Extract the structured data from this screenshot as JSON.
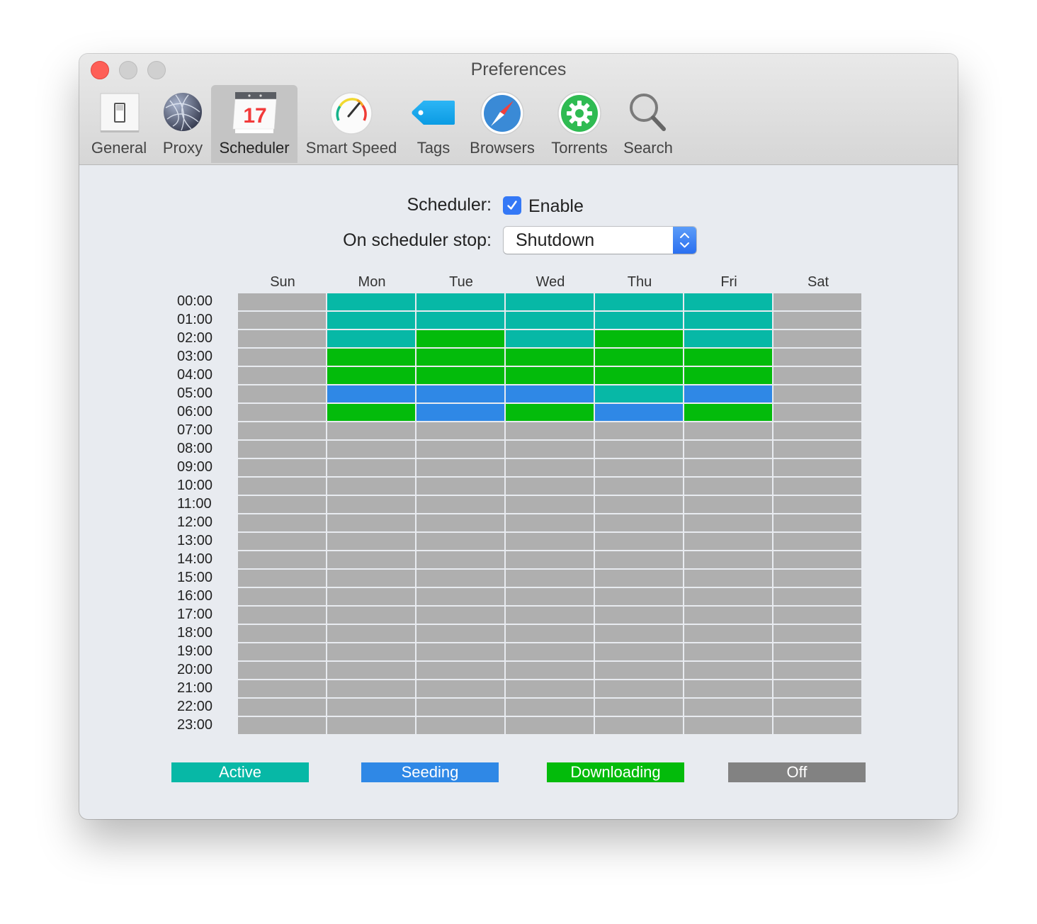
{
  "window": {
    "title": "Preferences"
  },
  "toolbar": {
    "items": [
      {
        "label": "General",
        "icon": "switch-icon"
      },
      {
        "label": "Proxy",
        "icon": "globe-network-icon"
      },
      {
        "label": "Scheduler",
        "icon": "calendar-icon",
        "calendar_day": "17",
        "selected": true
      },
      {
        "label": "Smart Speed",
        "icon": "speedometer-icon"
      },
      {
        "label": "Tags",
        "icon": "tag-icon"
      },
      {
        "label": "Browsers",
        "icon": "compass-icon"
      },
      {
        "label": "Torrents",
        "icon": "gear-icon"
      },
      {
        "label": "Search",
        "icon": "magnifier-icon"
      }
    ]
  },
  "scheduler": {
    "enable_label": "Scheduler:",
    "enable_checkbox_label": "Enable",
    "enabled": true,
    "on_stop_label": "On scheduler stop:",
    "on_stop_value": "Shutdown"
  },
  "grid": {
    "days": [
      "Sun",
      "Mon",
      "Tue",
      "Wed",
      "Thu",
      "Fri",
      "Sat"
    ],
    "hours": [
      "00:00",
      "01:00",
      "02:00",
      "03:00",
      "04:00",
      "05:00",
      "06:00",
      "07:00",
      "08:00",
      "09:00",
      "10:00",
      "11:00",
      "12:00",
      "13:00",
      "14:00",
      "15:00",
      "16:00",
      "17:00",
      "18:00",
      "19:00",
      "20:00",
      "21:00",
      "22:00",
      "23:00"
    ],
    "states_by_hour": [
      [
        "off",
        "active",
        "active",
        "active",
        "active",
        "active",
        "off"
      ],
      [
        "off",
        "active",
        "active",
        "active",
        "active",
        "active",
        "off"
      ],
      [
        "off",
        "active",
        "downloading",
        "active",
        "downloading",
        "active",
        "off"
      ],
      [
        "off",
        "downloading",
        "downloading",
        "downloading",
        "downloading",
        "downloading",
        "off"
      ],
      [
        "off",
        "downloading",
        "downloading",
        "downloading",
        "downloading",
        "downloading",
        "off"
      ],
      [
        "off",
        "seeding",
        "seeding",
        "seeding",
        "active",
        "seeding",
        "off"
      ],
      [
        "off",
        "downloading",
        "seeding",
        "downloading",
        "seeding",
        "downloading",
        "off"
      ],
      [
        "off",
        "off",
        "off",
        "off",
        "off",
        "off",
        "off"
      ],
      [
        "off",
        "off",
        "off",
        "off",
        "off",
        "off",
        "off"
      ],
      [
        "off",
        "off",
        "off",
        "off",
        "off",
        "off",
        "off"
      ],
      [
        "off",
        "off",
        "off",
        "off",
        "off",
        "off",
        "off"
      ],
      [
        "off",
        "off",
        "off",
        "off",
        "off",
        "off",
        "off"
      ],
      [
        "off",
        "off",
        "off",
        "off",
        "off",
        "off",
        "off"
      ],
      [
        "off",
        "off",
        "off",
        "off",
        "off",
        "off",
        "off"
      ],
      [
        "off",
        "off",
        "off",
        "off",
        "off",
        "off",
        "off"
      ],
      [
        "off",
        "off",
        "off",
        "off",
        "off",
        "off",
        "off"
      ],
      [
        "off",
        "off",
        "off",
        "off",
        "off",
        "off",
        "off"
      ],
      [
        "off",
        "off",
        "off",
        "off",
        "off",
        "off",
        "off"
      ],
      [
        "off",
        "off",
        "off",
        "off",
        "off",
        "off",
        "off"
      ],
      [
        "off",
        "off",
        "off",
        "off",
        "off",
        "off",
        "off"
      ],
      [
        "off",
        "off",
        "off",
        "off",
        "off",
        "off",
        "off"
      ],
      [
        "off",
        "off",
        "off",
        "off",
        "off",
        "off",
        "off"
      ],
      [
        "off",
        "off",
        "off",
        "off",
        "off",
        "off",
        "off"
      ],
      [
        "off",
        "off",
        "off",
        "off",
        "off",
        "off",
        "off"
      ]
    ],
    "state_colors": {
      "active": "#07b8a6",
      "seeding": "#2f88e6",
      "downloading": "#03bb0b",
      "off": "#afafaf"
    }
  },
  "legend": [
    {
      "key": "active",
      "label": "Active",
      "color": "#07b8a6"
    },
    {
      "key": "seeding",
      "label": "Seeding",
      "color": "#2f88e6"
    },
    {
      "key": "downloading",
      "label": "Downloading",
      "color": "#03bb0b"
    },
    {
      "key": "off",
      "label": "Off",
      "color": "#828282"
    }
  ]
}
